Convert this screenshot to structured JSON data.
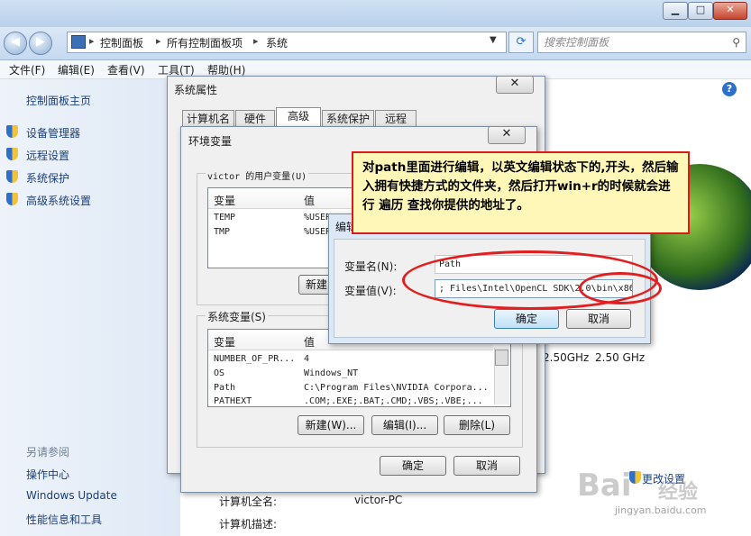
{
  "window": {
    "breadcrumb": [
      "控制面板",
      "所有控制面板项",
      "系统"
    ],
    "search_placeholder": "搜索控制面板",
    "min_label": "▁",
    "max_label": "□",
    "close_label": "✕"
  },
  "menu": [
    "文件(F)",
    "编辑(E)",
    "查看(V)",
    "工具(T)",
    "帮助(H)"
  ],
  "sidebar": {
    "home": "控制面板主页",
    "items": [
      "设备管理器",
      "远程设置",
      "系统保护",
      "高级系统设置"
    ],
    "see_also_title": "另请参阅",
    "see_also": [
      "操作中心",
      "Windows Update",
      "性能信息和工具"
    ]
  },
  "main": {
    "cpu_speed_1": "2.50GHz",
    "cpu_speed_2": "2.50 GHz",
    "change_settings": "更改设置",
    "computer_full_name_label": "计算机全名:",
    "computer_full_name_value": "victor-PC",
    "computer_desc_label": "计算机描述:"
  },
  "sysprops": {
    "title": "系统属性",
    "tabs": [
      "计算机名",
      "硬件",
      "高级",
      "系统保护",
      "远程"
    ]
  },
  "envvars": {
    "title": "环境变量",
    "user_group": "victor 的用户变量(U)",
    "col_var": "变量",
    "col_val": "值",
    "user_rows": [
      {
        "name": "TEMP",
        "value": "%USER"
      },
      {
        "name": "TMP",
        "value": "%USER"
      }
    ],
    "user_new": "新建",
    "sys_group": "系统变量(S)",
    "sys_rows": [
      {
        "name": "NUMBER_OF_PR...",
        "value": "4"
      },
      {
        "name": "OS",
        "value": "Windows_NT"
      },
      {
        "name": "Path",
        "value": "C:\\Program Files\\NVIDIA Corpora..."
      },
      {
        "name": "PATHEXT",
        "value": ".COM;.EXE;.BAT;.CMD;.VBS;.VBE;..."
      }
    ],
    "sys_new": "新建(W)...",
    "sys_edit": "编辑(I)...",
    "sys_delete": "删除(L)",
    "ok": "确定",
    "cancel": "取消"
  },
  "editvar": {
    "title": "编辑",
    "name_label": "变量名(N):",
    "name_value": "Path",
    "value_label": "变量值(V):",
    "value_value": "; Files\\Intel\\OpenCL SDK\\2.0\\bin\\x86",
    "ok": "确定",
    "cancel": "取消"
  },
  "callout": {
    "text": "对path里面进行编辑，以英文编辑状态下的,开头，然后输入拥有快捷方式的文件夹，然后打开win+r的时候就会进行 遍历 查找你提供的地址了。"
  },
  "watermark": {
    "brand": "Bai",
    "brand_cn": "经验",
    "url": "jingyan.baidu.com"
  },
  "colors": {
    "accent_red": "#d91b1b",
    "callout_bg": "#fff7b8",
    "link_blue": "#1a3f7a"
  }
}
